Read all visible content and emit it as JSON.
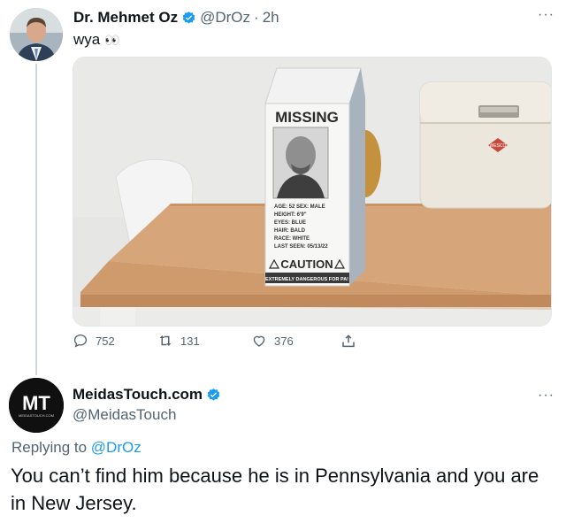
{
  "tweet": {
    "author_name": "Dr. Mehmet Oz",
    "handle": "@DrOz",
    "separator": "·",
    "time": "2h",
    "text": "wya",
    "emoji": "👀",
    "media": {
      "carton_title": "MISSING",
      "details": [
        "AGE: 52   SEX: MALE",
        "HEIGHT: 6'9\"",
        "EYES: BLUE",
        "HAIR: BALD",
        "RACE: WHITE",
        "LAST SEEN: 05/13/22"
      ],
      "caution_label": "CAUTION",
      "warning_strip": "EXTREMELY DANGEROUS FOR PA!",
      "bin_badge": "WESCO"
    },
    "actions": {
      "replies": "752",
      "retweets": "131",
      "likes": "376"
    }
  },
  "reply": {
    "author_name": "MeidasTouch.com",
    "handle": "@MeidasTouch",
    "avatar_letters": "MT",
    "avatar_subtext": "MEIDASTOUCH.COM",
    "replying_prefix": "Replying to",
    "replying_handle": "@DrOz",
    "text": "You can’t find him because he is in Pennsylvania and you are in New Jersey."
  },
  "colors": {
    "verified_blue": "#1d9bf0",
    "secondary_text": "#536471",
    "primary_text": "#0f1419"
  },
  "icons": [
    "verified-badge-icon",
    "more-icon",
    "reply-icon",
    "retweet-icon",
    "like-icon",
    "share-icon"
  ]
}
